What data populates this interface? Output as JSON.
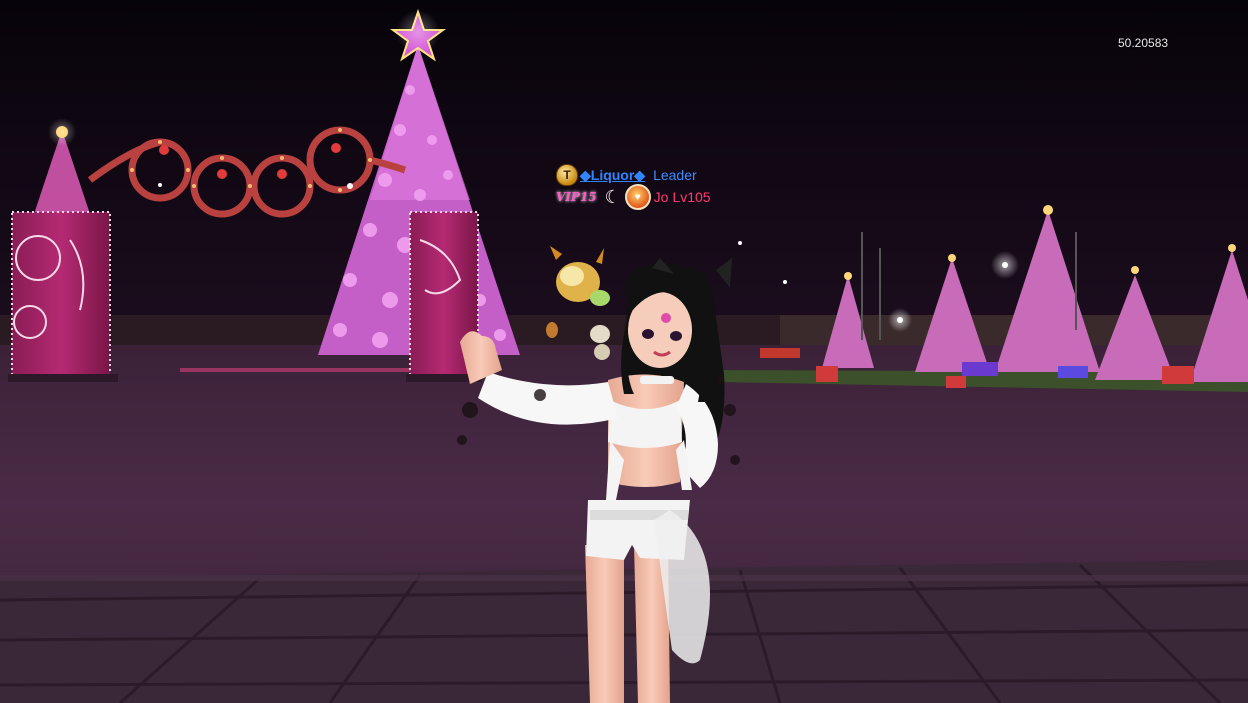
{
  "hud": {
    "fps": "50.20583"
  },
  "nameplate": {
    "guild_badge_letter": "T",
    "guild_name": "◆Liquor◆",
    "guild_role": "Leader",
    "vip_badge": "VIP15",
    "player_name": "Jo",
    "player_level": "Lv105"
  },
  "colors": {
    "sky": "#0d0510",
    "plaza": "#3a2438",
    "pink_lights": "#e86cd8",
    "guild_text": "#2f86ff",
    "player_text": "#ff3a70"
  }
}
